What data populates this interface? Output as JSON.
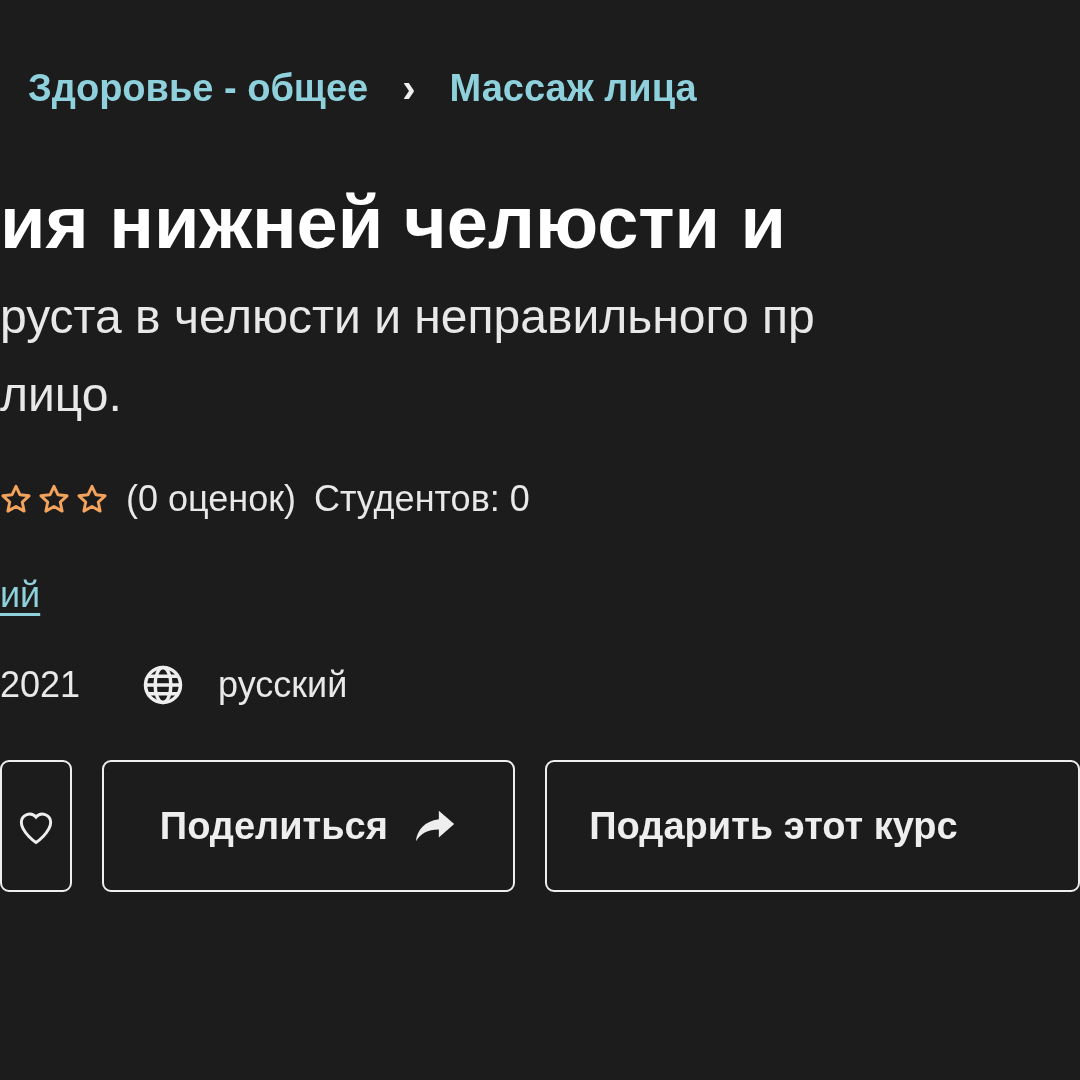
{
  "breadcrumb": [
    {
      "label": "Здоровье - общее"
    },
    {
      "label": "Массаж лица"
    }
  ],
  "breadcrumb_separator": "›",
  "title": "ия нижней челюсти и",
  "subtitle_lines": [
    "руста в челюсти и неправильного пр",
    "лицо."
  ],
  "rating": {
    "stars": 0,
    "count": "(0 оценок)",
    "students": "Студентов: 0"
  },
  "author_link": "ий",
  "updated": "2021",
  "language": "русский",
  "buttons": [
    {
      "kind": "wishlist"
    },
    {
      "kind": "share",
      "label": "Поделиться"
    },
    {
      "kind": "gift",
      "label": "Подарить этот курс"
    }
  ]
}
